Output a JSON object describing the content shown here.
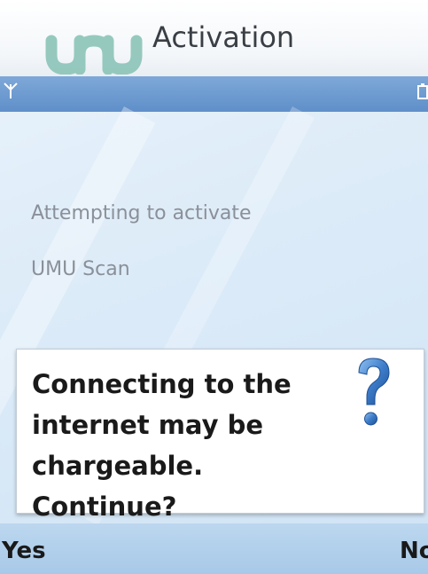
{
  "header": {
    "title": "Activation",
    "logo_icon": "umu-logo-icon",
    "logo_color": "#8cc4b8"
  },
  "status_bar": {
    "signal_icon": "signal-antenna-icon",
    "battery_icon": "battery-icon"
  },
  "content": {
    "line1": "Attempting to activate",
    "line2": "UMU Scan"
  },
  "dialog": {
    "message_line1": "Connecting to the",
    "message_line2": "internet may be",
    "message_line3": "chargeable. Continue?",
    "icon": "question-mark-icon"
  },
  "softkeys": {
    "left": "Yes",
    "right": "No"
  },
  "colors": {
    "strip": "#6e9bd1",
    "question_mark": "#3d7cc9"
  }
}
